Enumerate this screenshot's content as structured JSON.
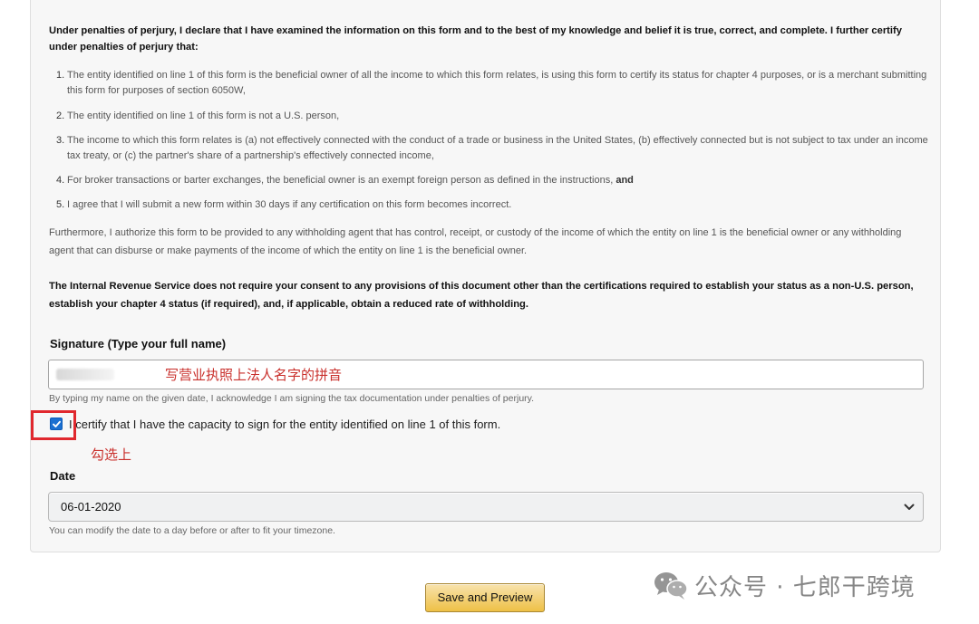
{
  "declaration": {
    "heading": "Under penalties of perjury, I declare that I have examined the information on this form and to the best of my knowledge and belief it is true, correct, and complete. I further certify under penalties of perjury that:",
    "items": [
      {
        "num": "1.",
        "text": "The entity identified on line 1 of this form is the beneficial owner of all the income to which this form relates, is using this form to certify its status for chapter 4 purposes, or is a merchant submitting this form for purposes of section 6050W,"
      },
      {
        "num": "2.",
        "text": "The entity identified on line 1 of this form is not a U.S. person,"
      },
      {
        "num": "3.",
        "text": "The income to which this form relates is (a) not effectively connected with the conduct of a trade or business in the United States, (b) effectively connected but is not subject to tax under an income tax treaty, or (c) the partner's share of a partnership's effectively connected income,"
      },
      {
        "num": "4.",
        "text": "For broker transactions or barter exchanges, the beneficial owner is an exempt foreign person as defined in the instructions,",
        "bold_suffix": "and"
      },
      {
        "num": "5.",
        "text": "I agree that I will submit a new form within 30 days if any certification on this form becomes incorrect."
      }
    ],
    "furthermore": "Furthermore, I authorize this form to be provided to any withholding agent that has control, receipt, or custody of the income of which the entity on line 1 is the beneficial owner or any withholding agent that can disburse or make payments of the income of which the entity on line 1 is the beneficial owner.",
    "irs_note": "The Internal Revenue Service does not require your consent to any provisions of this document other than the certifications required to establish your status as a non-U.S. person, establish your chapter 4 status (if required), and, if applicable, obtain a reduced rate of withholding."
  },
  "signature": {
    "label": "Signature (Type your full name)",
    "annotation": "写营业执照上法人名字的拼音",
    "note": "By typing my name on the given date, I acknowledge I am signing the tax documentation under penalties of perjury."
  },
  "certify": {
    "checked": true,
    "label": "I certify that I have the capacity to sign for the entity identified on line 1 of this form.",
    "annotation": "勾选上"
  },
  "date": {
    "label": "Date",
    "value": "06-01-2020",
    "note": "You can modify the date to a day before or after to fit your timezone."
  },
  "actions": {
    "save_preview": "Save and Preview"
  },
  "watermark": {
    "text": "公众号 · 七郎干跨境"
  },
  "colors": {
    "annotation_red": "#c9302c",
    "highlight_box": "#e0282e",
    "checkbox_blue": "#1a6fd1",
    "button_yellow": "#eec046"
  }
}
